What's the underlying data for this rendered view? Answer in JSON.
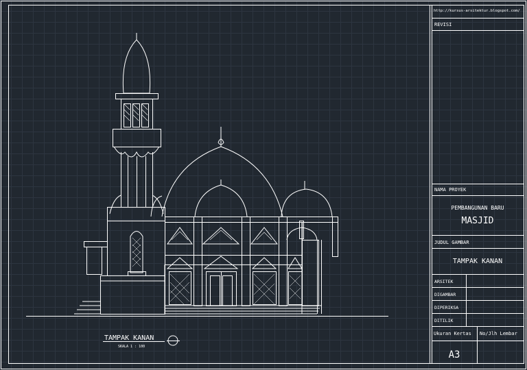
{
  "title_block": {
    "url": "http://kursus-arsitektur.blogspot.com/",
    "revision_label": "REVISI",
    "project_label": "NAMA PROYEK",
    "project_line1": "PEMBANGUNAN BARU",
    "project_line2": "MASJID",
    "drawing_title_label": "JUDUL GAMBAR",
    "drawing_title": "TAMPAK KANAN",
    "architect_label": "ARSITEK",
    "drawn_label": "DIGAMBAR",
    "checked_label": "DIPERIKSA",
    "inspected_label": "DITILIK",
    "paper_size_label": "Ukuran Kertas",
    "sheet_number_label": "No/Jlh Lembar",
    "paper_size_value": "A3"
  },
  "drawing": {
    "caption": "TAMPAK KANAN",
    "scale": "SKALA 1 : 100"
  },
  "colors": {
    "background": "#212830",
    "grid": "#2d3540",
    "lines": "#ffffff"
  }
}
